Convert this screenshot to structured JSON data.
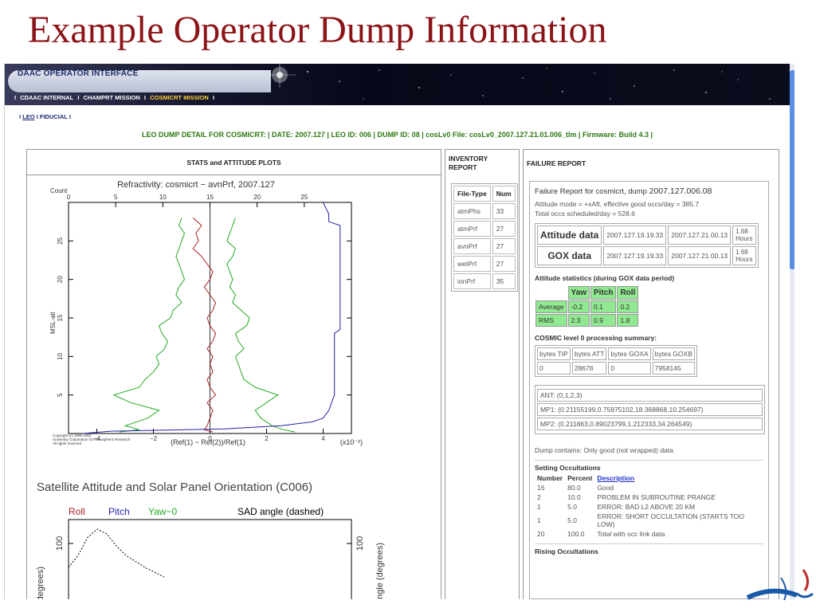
{
  "slide": {
    "title": "Example Operator Dump Information"
  },
  "header": {
    "title": "DAAC OPERATOR INTERFACE",
    "nav": [
      "CDAAC INTERNAL",
      "CHAMPRT MISSION",
      "COSMICRT MISSION"
    ],
    "active_nav_index": 2,
    "sep": "I"
  },
  "subnav": {
    "items": [
      "LEO",
      "FIDUCIAL"
    ]
  },
  "dump_line": "LEO DUMP DETAIL FOR COSMICRT: | DATE: 2007.127 | LEO ID: 006 | DUMP ID: 08 | cosLv0 File: cosLv0_2007.127.21.01.006_tlm | Firmware: Build 4.3 |",
  "panels": {
    "stats_title": "STATS and ATTITUDE PLOTS",
    "inventory_title": "INVENTORY REPORT",
    "failure_title": "FAILURE REPORT"
  },
  "inventory": {
    "headers": [
      "File-Type",
      "Num"
    ],
    "rows": [
      [
        "atmPhs",
        "33"
      ],
      [
        "atmPrf",
        "27"
      ],
      [
        "avnPrf",
        "27"
      ],
      [
        "wetPrf",
        "27"
      ],
      [
        "ionPrf",
        "35"
      ]
    ]
  },
  "failure": {
    "title_prefix": "Failure Report for cosmicrt, dump",
    "title_id": "2007.127.006.08",
    "attitude_mode": "Attitude mode = +xAft, effective good occs/day = 385.7",
    "total_occs": "Total occs scheduled/day = 528.6",
    "data_rows": [
      {
        "label": "Attitude data",
        "start": "2007.127.19.19.33",
        "end": "2007.127.21.00.13",
        "dur": "1.68",
        "unit": "Hours"
      },
      {
        "label": "GOX data",
        "start": "2007.127.19.19.33",
        "end": "2007.127.21.00.13",
        "dur": "1.68",
        "unit": "Hours"
      }
    ],
    "att_stats_title": "Attitude statistics (during GOX data period)",
    "att_stats_headers": [
      "Yaw",
      "Pitch",
      "Roll"
    ],
    "att_stats_rows": [
      [
        "Average",
        "-0.2",
        "0.1",
        "0.2"
      ],
      [
        "RMS",
        "2.3",
        "0.9",
        "1.8"
      ]
    ],
    "cosmic_title": "COSMIC level 0 processing summary:",
    "bytes_headers": [
      "bytes TIP",
      "bytes ATT",
      "bytes GOXA",
      "bytes GOXB"
    ],
    "bytes_values": [
      "0",
      "28678",
      "0",
      "7958145"
    ],
    "ant": "ANT: (0,1,2,3)",
    "mp1": "MP1: (0.21155199,0.75975102,18.368868,10.254697)",
    "mp2": "MP2: (0.211863,0.89023799,1.212333,34.264549)",
    "dump_contains": "Dump contains: Only good (not wrapped) data",
    "setting_title": "Setting Occultations",
    "occ_headers": [
      "Number",
      "Percent",
      "Description"
    ],
    "occ_rows": [
      [
        "16",
        "80.0",
        "Good"
      ],
      [
        "2",
        "10.0",
        "PROBLEM IN SUBROUTINE PRANGE"
      ],
      [
        "1",
        "5.0",
        "ERROR: BAD L2 ABOVE 20 KM"
      ],
      [
        "1",
        "5.0",
        "ERROR: SHORT OCCULTATION (STARTS TOO LOW)"
      ],
      [
        "20",
        "100.0",
        "Total with occ link data"
      ]
    ],
    "rising_title": "Rising Occultations"
  },
  "chart_data": [
    {
      "type": "line",
      "title": "Refractivity:  cosmicrt − avnPrf, 2007.127",
      "xlabel": "(Ref(1) − Ref(2))/Ref(1)",
      "xlabel_units": "(x10⁻²)",
      "ylabel": "MSL-alt",
      "xlim": [
        -5,
        5
      ],
      "ylim": [
        0,
        30
      ],
      "x_ticks": [
        -4,
        -2,
        0,
        2,
        4
      ],
      "y_ticks": [
        5,
        10,
        15,
        20,
        25
      ],
      "top_axis_label": "Count",
      "top_axis_lim": [
        0,
        30
      ],
      "top_axis_ticks": [
        0,
        5,
        10,
        15,
        20,
        25
      ],
      "copyright": [
        "Copyright (c) 1999-2002",
        "University Corporation for Atmospheric Research",
        "All rights reserved"
      ],
      "series": [
        {
          "color": "#22aa22",
          "y": [
            0.2,
            0.5,
            1,
            2,
            3,
            4,
            5,
            6,
            7,
            8,
            9,
            10,
            11,
            12,
            13,
            14,
            15,
            16,
            17,
            18,
            19,
            20,
            21,
            22,
            23,
            24,
            25,
            26,
            27,
            28
          ],
          "x": [
            -3.2,
            -2.5,
            -3,
            -2.2,
            -1.8,
            -2.8,
            -3.4,
            -2.5,
            -2.3,
            -2.0,
            -1.8,
            -1.9,
            -1.6,
            -1.5,
            -1.7,
            -1.8,
            -1.4,
            -1.3,
            -1.0,
            -1.2,
            -1.1,
            -0.9,
            -1.0,
            -1.1,
            -1.2,
            -1.1,
            -1.0,
            -0.9,
            -1.1,
            -1.0
          ]
        },
        {
          "color": "#22aa22",
          "y": [
            0.2,
            0.5,
            1,
            2,
            3,
            4,
            5,
            6,
            7,
            8,
            9,
            10,
            11,
            12,
            13,
            14,
            15,
            16,
            17,
            18,
            19,
            20,
            21,
            22,
            23,
            24,
            25,
            26,
            27,
            28
          ],
          "x": [
            3.0,
            2.6,
            2.2,
            1.8,
            1.6,
            2.0,
            2.4,
            1.6,
            1.2,
            1.1,
            1.0,
            0.9,
            1.2,
            1.0,
            0.9,
            1.3,
            1.4,
            1.1,
            0.8,
            0.9,
            0.7,
            0.8,
            0.7,
            0.6,
            0.8,
            0.9,
            0.6,
            0.7,
            0.8,
            0.9
          ]
        },
        {
          "color": "#aa2222",
          "y": [
            0.2,
            0.5,
            1,
            2,
            3,
            4,
            5,
            6,
            7,
            8,
            9,
            10,
            11,
            12,
            13,
            14,
            15,
            16,
            17,
            18,
            19,
            20,
            21,
            22,
            23,
            24,
            25,
            26,
            27,
            28
          ],
          "x": [
            0.1,
            -0.2,
            -0.1,
            0.0,
            0.1,
            -0.1,
            0.2,
            0.0,
            -0.1,
            0.1,
            0.0,
            0.1,
            -0.1,
            0.1,
            0.2,
            0.0,
            -0.1,
            0.1,
            0.2,
            0.0,
            -0.2,
            0.0,
            0.1,
            -0.1,
            -0.3,
            -0.6,
            -0.4,
            -0.5,
            -0.3,
            -0.6
          ]
        },
        {
          "color": "#2222aa",
          "y": [
            0,
            0.3,
            0.6,
            1,
            1.5,
            2,
            3,
            5,
            8,
            13,
            13.5,
            16,
            22,
            26,
            27,
            27.5,
            28.5,
            30
          ],
          "x": [
            -4.5,
            -3.5,
            0.5,
            2.5,
            3.6,
            4.0,
            4.2,
            4.4,
            4.4,
            4.4,
            4.6,
            4.6,
            4.6,
            4.6,
            4.6,
            4.2,
            4.2,
            4.0
          ]
        }
      ]
    },
    {
      "type": "line",
      "title": "Satellite Attitude and Solar Panel Orientation (C006)",
      "legend": [
        "Roll",
        "Pitch",
        "Yaw−0",
        "SAD angle (dashed)"
      ],
      "legend_colors": [
        "#aa2222",
        "#2222aa",
        "#22aa22",
        "#000000"
      ],
      "ylabel_left": "(degrees)",
      "ylabel_right": "angle (degrees)",
      "y_ticks": [
        100
      ],
      "series": [
        {
          "name": "SAD angle (dashed)",
          "color": "#000000",
          "x": [
            0,
            1,
            2,
            3,
            4,
            5,
            6,
            7,
            8,
            9,
            10
          ],
          "y": [
            80,
            90,
            105,
            112,
            108,
            98,
            90,
            85,
            80,
            76,
            72
          ]
        }
      ]
    }
  ]
}
